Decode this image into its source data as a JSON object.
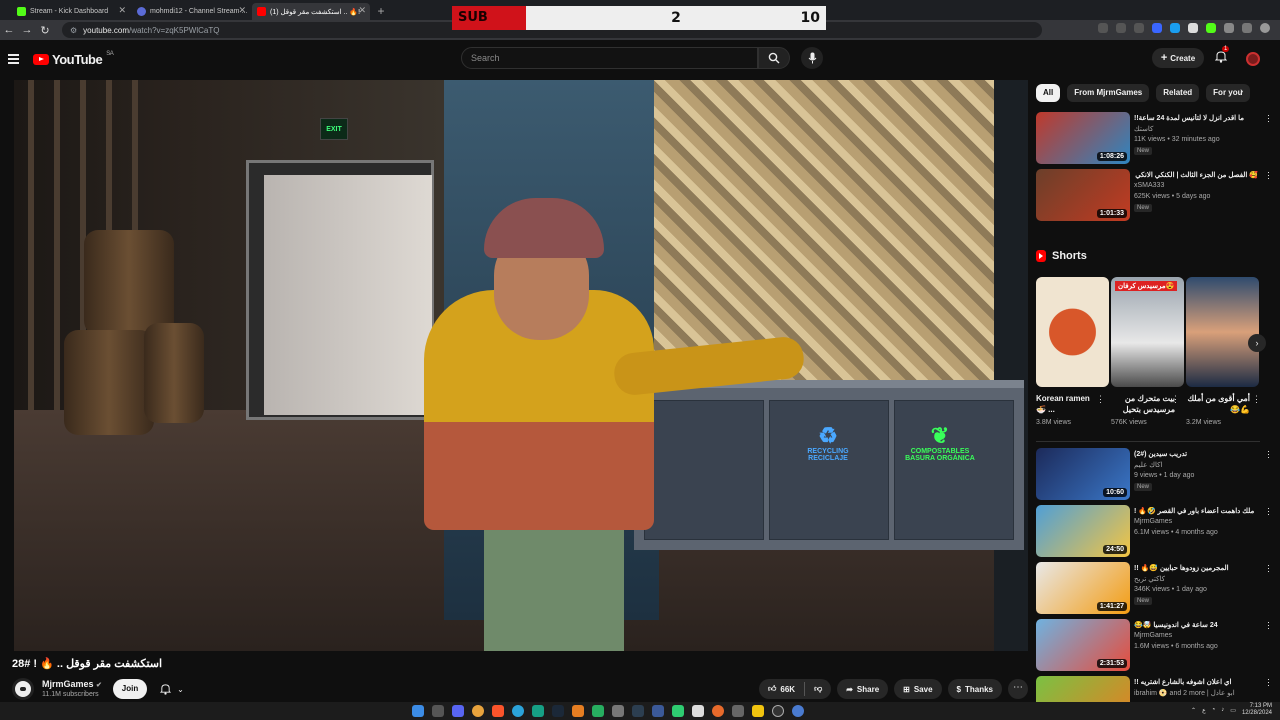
{
  "browser": {
    "tabs": [
      {
        "label": "Stream - Kick Dashboard",
        "color": "#53fc18",
        "active": false
      },
      {
        "label": "mohmdi12 - Channel Stream ...",
        "color": "#5b6bd6",
        "active": false
      },
      {
        "label": "(1) استكشفت مقر قوقل .. 🔥!",
        "color": "#ff0000",
        "active": true
      }
    ],
    "url_host": "youtube.com",
    "url_path": "/watch?v=zqK5PWlCaTQ"
  },
  "overlay": {
    "team_label": "SUB",
    "score_mid": "2",
    "score_right": "10"
  },
  "header": {
    "logo_text": "YouTube",
    "logo_region": "SA",
    "search_placeholder": "Search",
    "create_label": "Create",
    "notification_count": "1"
  },
  "video": {
    "title": "استكشفت مقر قوقل .. 🔥 ! #28",
    "exit_sign": "EXIT",
    "recycling_label": "RECYCLING RECICLAJE",
    "compost_label": "COMPOSTABLES BASURA ORGÁNICA"
  },
  "channel": {
    "name": "MjrmGames",
    "subscribers": "11.1M subscribers",
    "join_label": "Join"
  },
  "actions": {
    "likes": "66K",
    "share": "Share",
    "save": "Save",
    "thanks": "Thanks"
  },
  "sidebar": {
    "chips": [
      "All",
      "From MjrmGames",
      "Related",
      "For you"
    ],
    "recommendations_top": [
      {
        "title": "ما اقدر انزل لا لتأنيس لمدة 24 ساعة!!",
        "channel": "كاستك",
        "meta": "11K views • 32 minutes ago",
        "badge": "New",
        "duration": "1:08:26",
        "colors": [
          "#c0392b",
          "#2e86c1"
        ]
      },
      {
        "title": "🥰 الفصل من الجزء الثالث | الكنكي الانكي ❌",
        "channel": "xSMA333",
        "meta": "625K views • 5 days ago",
        "badge": "New",
        "duration": "1:01:33",
        "colors": [
          "#6b3f2a",
          "#c23b22"
        ]
      }
    ],
    "shorts_heading": "Shorts",
    "shorts": [
      {
        "title": "Korean ramen 🍜 ...",
        "views": "3.8M views",
        "colors": [
          "#f0e4d0",
          "#d8572a"
        ]
      },
      {
        "title": "بيت متحرك من مرسيدس بتحيل",
        "views": "576K views",
        "overlay": "مرسيدس كرفان😍",
        "colors": [
          "#9aa4ae",
          "#e8e8e8"
        ]
      },
      {
        "title": "أمي أقوى من أملك 💪😂",
        "views": "3.2M views",
        "colors": [
          "#2f4b6e",
          "#d9a07a"
        ]
      }
    ],
    "recommendations_bottom": [
      {
        "title": "تدريب سيدين (#2)",
        "channel": "اكاك عليم",
        "meta": "9 views • 1 day ago",
        "badge": "New",
        "duration": "10:60",
        "colors": [
          "#1c2a5a",
          "#3a77c8"
        ]
      },
      {
        "title": "ملك داهمت أعضاء باور في القصر 🤣🔥 !",
        "channel": "MjrmGames",
        "meta": "6.1M views • 4 months ago",
        "badge": "",
        "duration": "24:50",
        "colors": [
          "#4f9fd6",
          "#f4c542"
        ]
      },
      {
        "title": "المجرمين زودوها حبايين 😅🔥 !!",
        "channel": "كاكتي تربح",
        "meta": "346K views • 1 day ago",
        "badge": "New",
        "duration": "1:41:27",
        "colors": [
          "#e8e8e8",
          "#f39c12"
        ]
      },
      {
        "title": "24 ساعة في اندونيسيا 🤯😂",
        "channel": "MjrmGames",
        "meta": "1.6M views • 6 months ago",
        "badge": "",
        "duration": "2:31:53",
        "colors": [
          "#6fb2e0",
          "#e74c3c"
        ]
      },
      {
        "title": "اي اعلان اشوفه بالشارع اشتريه !!",
        "channel": "ibrahim 📀 and 2 more | ابو عادل",
        "meta": "",
        "badge": "",
        "duration": "",
        "colors": [
          "#7ac143",
          "#e67e22"
        ]
      }
    ]
  },
  "taskbar": {
    "time": "7:13 PM",
    "date": "12/28/2024"
  }
}
